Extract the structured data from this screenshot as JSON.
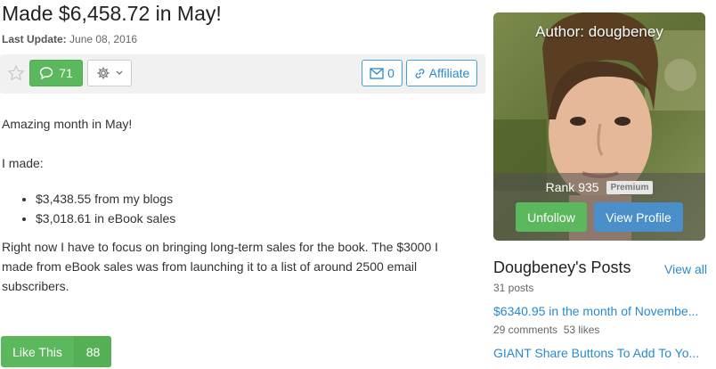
{
  "article": {
    "title": "Made $6,458.72 in May!",
    "update_label": "Last Update:",
    "update_date": "June 08, 2016",
    "comments_count": "71",
    "messages_count": "0",
    "affiliate_label": "Affiliate",
    "p1": "Amazing month in May!",
    "p2": "I made:",
    "items": [
      "$3,438.55 from my blogs",
      "$3,018.61 in eBook sales"
    ],
    "p3": "Right now I have to focus on bringing long-term sales for the book. The $3000 I made from eBook sales was from launching it to a list of around 2500 email subscribers.",
    "like_label": "Like This",
    "like_count": "88"
  },
  "author": {
    "heading": "Author: dougbeney",
    "rank": "Rank 935",
    "badge": "Premium",
    "unfollow_label": "Unfollow",
    "view_profile_label": "View Profile"
  },
  "posts": {
    "heading": "Dougbeney's Posts",
    "view_all": "View all",
    "count": "31 posts",
    "items": [
      {
        "title": "$6340.95 in the month of Novembe...",
        "comments": "29 comments",
        "likes": "53 likes"
      },
      {
        "title": "GIANT Share Buttons To Add To Yo...",
        "comments": "",
        "likes": ""
      }
    ]
  },
  "colors": {
    "green": "#5cb85c",
    "blue": "#2a8acd",
    "profile_blue": "#4a8fc9"
  }
}
